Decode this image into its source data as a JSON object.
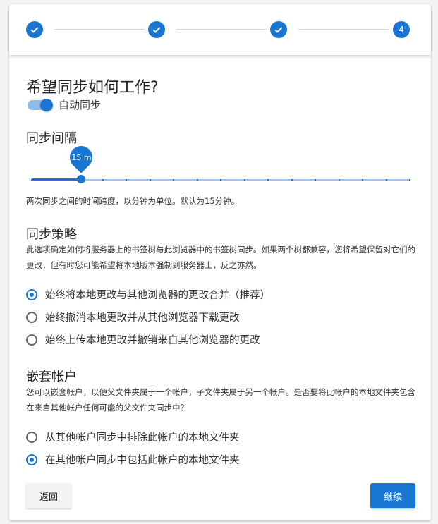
{
  "stepper": {
    "steps": [
      {
        "state": "done",
        "icon": "check-icon"
      },
      {
        "state": "done",
        "icon": "check-icon"
      },
      {
        "state": "done",
        "icon": "check-icon"
      },
      {
        "state": "current",
        "label": "4"
      }
    ],
    "accent": "#1976d2"
  },
  "page": {
    "title": "希望同步如何工作?",
    "auto_sync": {
      "label": "自动同步",
      "enabled": true
    }
  },
  "interval": {
    "title": "同步间隔",
    "value_label": "15 m",
    "value_minutes": 15,
    "help": "两次同步之间的时间跨度，以分钟为单位。默认为15分钟。"
  },
  "strategy": {
    "title": "同步策略",
    "desc": "此选项确定如何将服务器上的书签树与此浏览器中的书签树同步。如果两个树都兼容，您将希望保留对它们的更改，但有时您可能希望将本地版本强制到服务器上，反之亦然。",
    "options": [
      {
        "label": "始终将本地更改与其他浏览器的更改合并（推荐）",
        "checked": true
      },
      {
        "label": "始终撤消本地更改并从其他浏览器下载更改",
        "checked": false
      },
      {
        "label": "始终上传本地更改并撤销来自其他浏览器的更改",
        "checked": false
      }
    ]
  },
  "nested": {
    "title": "嵌套帐户",
    "desc": "您可以嵌套帐户，以便父文件夹属于一个帐户，子文件夹属于另一个帐户。是否要将此帐户的本地文件夹包含在来自其他帐户任何可能的父文件夹同步中？",
    "options": [
      {
        "label": "从其他帐户同步中排除此帐户的本地文件夹",
        "checked": false
      },
      {
        "label": "在其他帐户同步中包括此帐户的本地文件夹",
        "checked": true
      }
    ]
  },
  "buttons": {
    "back": "返回",
    "next": "继续"
  }
}
